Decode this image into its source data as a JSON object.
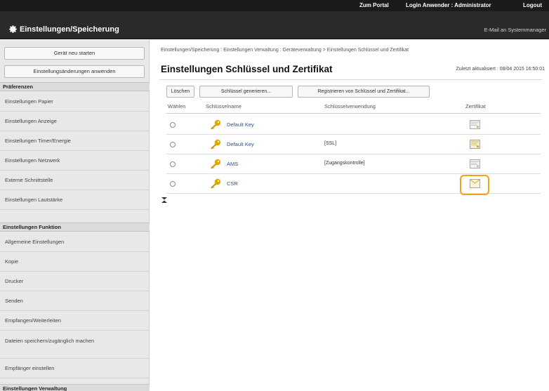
{
  "header": {
    "portal_link": "Zum Portal",
    "login_user": "Login Anwender : Administrator",
    "logout": "Logout",
    "app_title": "Einstellungen/Speicherung",
    "mail_link": "E-Mail an Systemmanager"
  },
  "sidebar": {
    "restart_button": "Gerät neu starten",
    "apply_button": "Einstellungsänderungen anwenden",
    "sections": [
      {
        "heading": "Präferenzen",
        "items": [
          "Einstellungen Papier",
          "Einstellungen Anzeige",
          "Einstellungen Timer/Energie",
          "Einstellungen Netzwerk",
          "Externe Schnittstelle",
          "Einstellungen Lautstärke"
        ]
      },
      {
        "heading": "Einstellungen Funktion",
        "items": [
          "Allgemeine Einstellungen",
          "Kopie",
          "Drucker",
          "Senden",
          "Empfangen/Weiterleiten",
          "Dateien speichern/zugänglich machen",
          "Empfänger einstellen"
        ]
      },
      {
        "heading": "Einstellungen Verwaltung",
        "items": []
      }
    ]
  },
  "main": {
    "breadcrumb": "Einstellungen/Speicherung : Einstellungen Verwaltung : Geräteverwaltung > Einstellungen Schlüssel und Zertifikat",
    "title": "Einstellungen Schlüssel und Zertifikat",
    "last_updated": "Zuletzt aktualisiert : 08/04 2015 16:50:01",
    "toolbar": {
      "delete": "Löschen",
      "generate_key": "Schlüssel generieren...",
      "register": "Registrieren von Schlüssel und Zertifikat..."
    },
    "table": {
      "columns": [
        "Wählen",
        "Schlüsselname",
        "Schlüsselverwendung",
        "Zertifikat"
      ],
      "rows": [
        {
          "name": "Default Key",
          "usage": ""
        },
        {
          "name": "Default Key",
          "usage": "[SSL]"
        },
        {
          "name": "AMS",
          "usage": "[Zugangskontrolle]"
        },
        {
          "name": "CSR",
          "usage": ""
        }
      ]
    }
  },
  "colors": {
    "topbar": "#1b1b1b",
    "titlebar": "#2a2a2a",
    "sidebar": "#e8e8e8",
    "link": "#2b4f9b",
    "highlight": "#f0a21a",
    "key_icon": "#e0a800"
  },
  "icons": {
    "app": "gear-icon",
    "key": "key-icon",
    "certificate": "certificate-icon",
    "collapse": "collapse-icon"
  }
}
